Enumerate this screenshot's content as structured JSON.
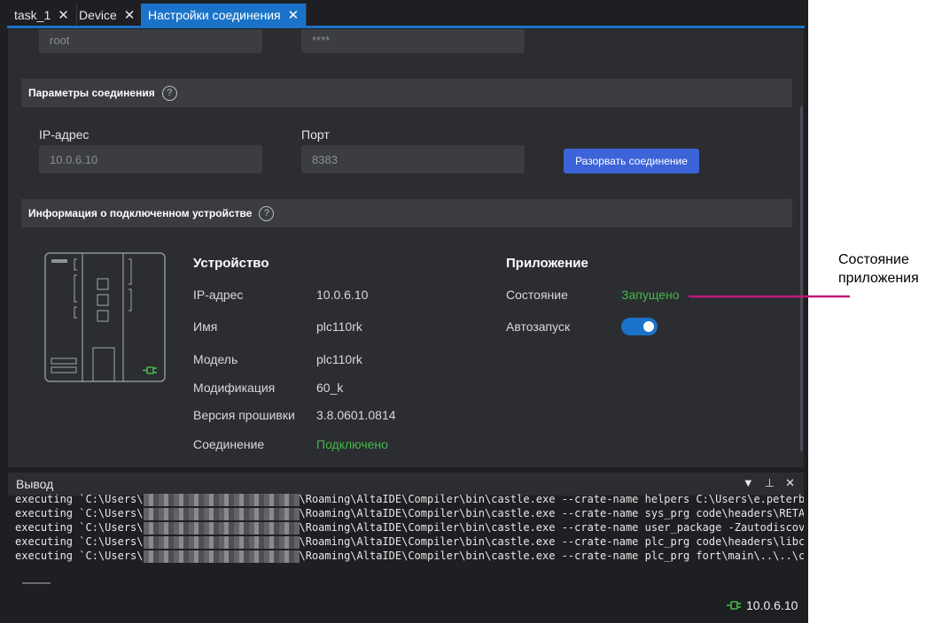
{
  "tabs": [
    {
      "label": "task_1",
      "active": false
    },
    {
      "label": "Device",
      "active": false
    },
    {
      "label": "Настройки соединения",
      "active": true
    }
  ],
  "login": {
    "user_value": "root",
    "password_value": "****"
  },
  "connection_section": {
    "title": "Параметры соединения"
  },
  "connection": {
    "ip_label": "IP-адрес",
    "ip_value": "10.0.6.10",
    "port_label": "Порт",
    "port_value": "8383",
    "disconnect_button": "Разорвать соединение"
  },
  "device_section": {
    "title": "Информация о подключенном устройстве"
  },
  "device": {
    "heading": "Устройство",
    "rows": [
      {
        "key": "IP-адрес",
        "value": "10.0.6.10"
      },
      {
        "key": "Имя",
        "value": "plc110rk"
      },
      {
        "key": "Модель",
        "value": "plc110rk"
      },
      {
        "key": "Модификация",
        "value": "60_k"
      },
      {
        "key": "Версия прошивки",
        "value": "3.8.0601.0814"
      },
      {
        "key": "Соединение",
        "value": "Подключено"
      }
    ]
  },
  "application": {
    "heading": "Приложение",
    "state_label": "Состояние",
    "state_value": "Запущено",
    "autostart_label": "Автозапуск",
    "autostart_on": true
  },
  "output": {
    "title": "Вывод",
    "lines": [
      {
        "prefix": "executing `C:\\Users\\",
        "suffix": "\\Roaming\\AltaIDE\\Compiler\\bin\\castle.exe --crate-name helpers C:\\Users\\e.peterb"
      },
      {
        "prefix": "executing `C:\\Users\\",
        "suffix": "\\Roaming\\AltaIDE\\Compiler\\bin\\castle.exe --crate-name sys_prg code\\headers\\RETA"
      },
      {
        "prefix": "executing `C:\\Users\\",
        "suffix": "\\Roaming\\AltaIDE\\Compiler\\bin\\castle.exe --crate-name user_package -Zautodiscov"
      },
      {
        "prefix": "executing `C:\\Users\\",
        "suffix": "\\Roaming\\AltaIDE\\Compiler\\bin\\castle.exe --crate-name plc_prg code\\headers\\libc"
      },
      {
        "prefix": "executing `C:\\Users\\",
        "suffix": "\\Roaming\\AltaIDE\\Compiler\\bin\\castle.exe --crate-name plc_prg fort\\main\\..\\..\\c"
      }
    ]
  },
  "statusbar": {
    "ip": "10.0.6.10"
  },
  "annotation": {
    "text": "Состояние приложения",
    "color": "#c0177a"
  },
  "colors": {
    "accent": "#1a73c8",
    "button": "#3d63d9",
    "ok": "#45b84a"
  }
}
